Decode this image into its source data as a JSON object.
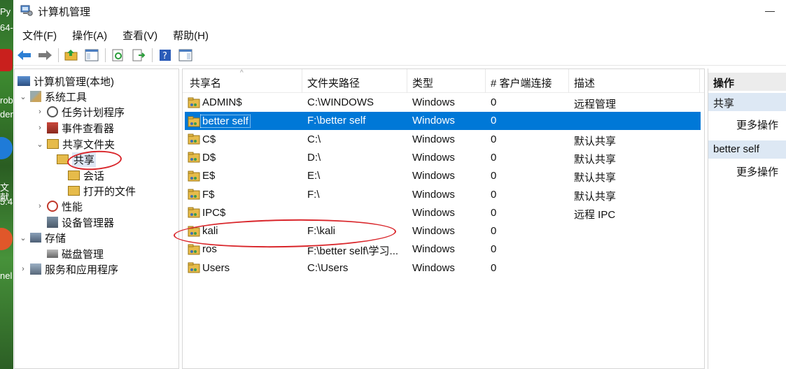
{
  "desktop": {
    "fragments": [
      "Py",
      "64-",
      "rob",
      "der",
      "文献",
      "5.4",
      "nel"
    ]
  },
  "window": {
    "title": "计算机管理"
  },
  "menu": [
    "文件(F)",
    "操作(A)",
    "查看(V)",
    "帮助(H)"
  ],
  "toolbar": {
    "buttons": [
      "back-arrow-icon",
      "forward-arrow-icon",
      "up-folder-icon",
      "show-hide-tree-icon",
      "refresh-icon",
      "export-list-icon",
      "help-icon",
      "show-hide-action-pane-icon"
    ]
  },
  "tree": {
    "root": "计算机管理(本地)",
    "system_tools": "系统工具",
    "task_scheduler": "任务计划程序",
    "event_viewer": "事件查看器",
    "shared_folders": "共享文件夹",
    "shares": "共享",
    "sessions": "会话",
    "open_files": "打开的文件",
    "performance": "性能",
    "device_manager": "设备管理器",
    "storage": "存储",
    "disk_management": "磁盘管理",
    "services_apps": "服务和应用程序"
  },
  "list": {
    "columns": [
      "共享名",
      "文件夹路径",
      "类型",
      "# 客户端连接",
      "描述"
    ],
    "rows": [
      {
        "name": "ADMIN$",
        "path": "C:\\WINDOWS",
        "type": "Windows",
        "clients": "0",
        "desc": "远程管理"
      },
      {
        "name": "better self",
        "path": "F:\\better self",
        "type": "Windows",
        "clients": "0",
        "desc": ""
      },
      {
        "name": "C$",
        "path": "C:\\",
        "type": "Windows",
        "clients": "0",
        "desc": "默认共享"
      },
      {
        "name": "D$",
        "path": "D:\\",
        "type": "Windows",
        "clients": "0",
        "desc": "默认共享"
      },
      {
        "name": "E$",
        "path": "E:\\",
        "type": "Windows",
        "clients": "0",
        "desc": "默认共享"
      },
      {
        "name": "F$",
        "path": "F:\\",
        "type": "Windows",
        "clients": "0",
        "desc": "默认共享"
      },
      {
        "name": "IPC$",
        "path": "",
        "type": "Windows",
        "clients": "0",
        "desc": "远程 IPC"
      },
      {
        "name": "kali",
        "path": "F:\\kali",
        "type": "Windows",
        "clients": "0",
        "desc": ""
      },
      {
        "name": "ros",
        "path": "F:\\better self\\学习...",
        "type": "Windows",
        "clients": "0",
        "desc": ""
      },
      {
        "name": "Users",
        "path": "C:\\Users",
        "type": "Windows",
        "clients": "0",
        "desc": ""
      }
    ]
  },
  "actions": {
    "header": "操作",
    "section1": "共享",
    "more1": "更多操作",
    "section2": "better self",
    "more2": "更多操作"
  },
  "colors": {
    "selection": "#0078d7",
    "annotation": "#d9262b"
  }
}
